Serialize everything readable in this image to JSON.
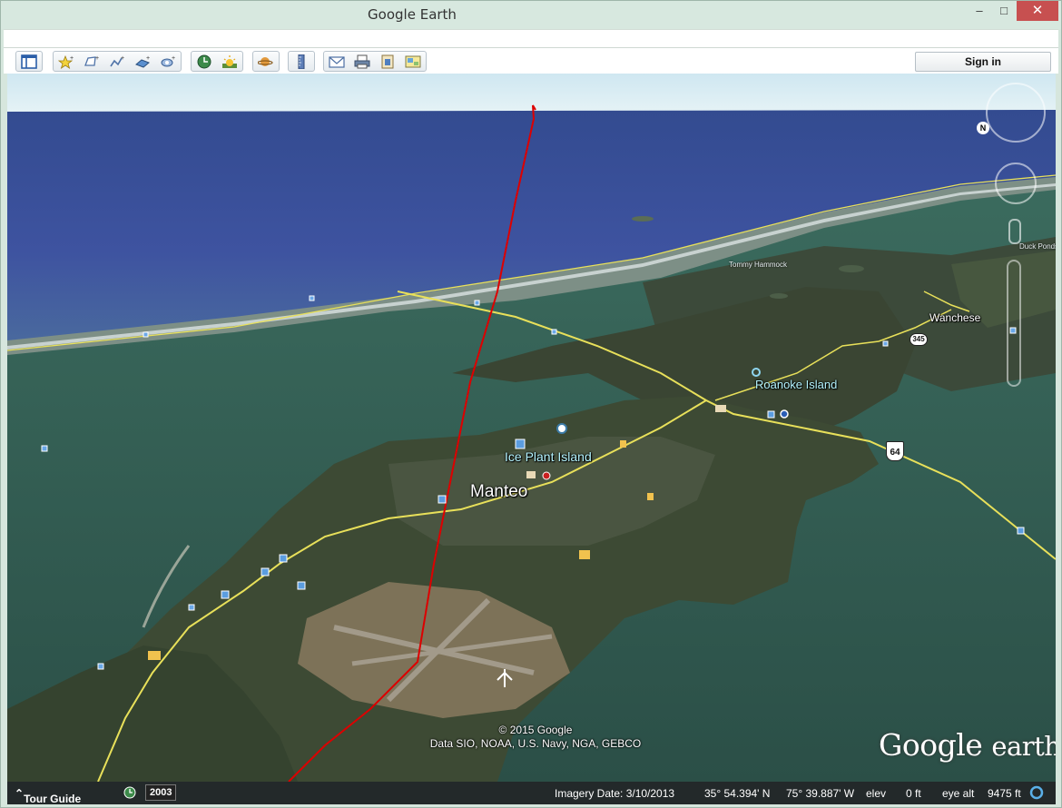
{
  "window": {
    "title": "Google Earth",
    "controls": {
      "minimize": "–",
      "maximize": "□",
      "close": "✕"
    }
  },
  "toolbar": {
    "groups": [
      [
        "hide-sidebar-icon"
      ],
      [
        "add-placemark-icon",
        "add-polygon-icon",
        "add-path-icon",
        "add-image-overlay-icon",
        "record-tour-icon"
      ],
      [
        "historical-imagery-icon",
        "sunlight-icon"
      ],
      [
        "switch-planet-icon"
      ],
      [
        "ruler-icon"
      ],
      [
        "email-icon",
        "print-icon",
        "save-image-icon",
        "view-in-maps-icon"
      ]
    ],
    "sign_in_label": "Sign in"
  },
  "map": {
    "places": {
      "manteo": "Manteo",
      "ice_plant_island": "Ice Plant Island",
      "roanoke_island": "Roanoke Island",
      "wanchese": "Wanchese",
      "tommy_hammock": "Tommy Hammock",
      "duck": "Duck Ponds"
    },
    "shields": {
      "us64": "64",
      "nc345": "345"
    },
    "attribution_line1": "© 2015 Google",
    "attribution_line2": "Data SIO, NOAA, U.S. Navy, NGA, GEBCO",
    "logo_word1": "Google",
    "logo_word2": "earth",
    "compass_n": "N",
    "colors": {
      "path": "#dd0000",
      "road": "#e8e05a",
      "water": "#2f5d58",
      "ocean": "#3c4f9a",
      "land": "#3d4a35"
    }
  },
  "status": {
    "tour_guide": "Tour Guide",
    "year": "2003",
    "imagery_date": "Imagery Date: 3/10/2013",
    "latitude": "35° 54.394' N",
    "longitude": "75° 39.887' W",
    "elev_label": "elev",
    "elev_value": "0 ft",
    "eye_alt_label": "eye alt",
    "eye_alt_value": "9475 ft"
  }
}
